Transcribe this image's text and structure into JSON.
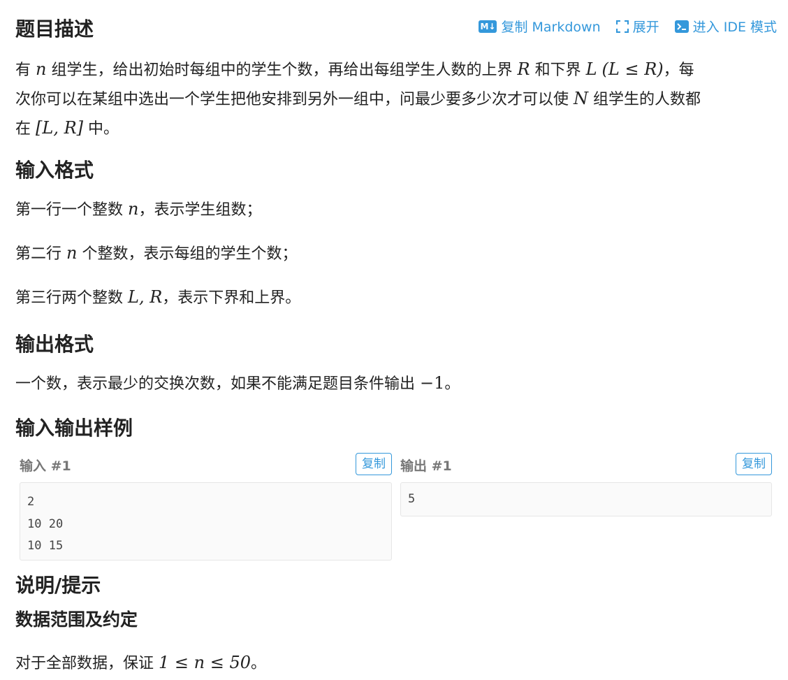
{
  "header": {
    "title": "题目描述",
    "actions": {
      "copy_markdown": "复制 Markdown",
      "expand": "展开",
      "ide_mode": "进入 IDE 模式"
    }
  },
  "description": {
    "p1": "有",
    "n": "n",
    "p2": "组学生，给出初始时每组中的学生个数，再给出每组学生人数的上界",
    "R": "R",
    "p3": "和下界",
    "L": "L",
    "cond": "(L ≤ R)",
    "p4": "，每",
    "line2a": "次你可以在某组中选出一个学生把他安排到另外一组中，问最少要多少次才可以使",
    "N": "N",
    "line2b": "组学生的人数都",
    "line3a": "在",
    "interval": "[L, R]",
    "line3b": "中。"
  },
  "input_format": {
    "title": "输入格式",
    "line1a": "第一行一个整数",
    "line1m": "n",
    "line1b": "，表示学生组数；",
    "line2a": "第二行",
    "line2m": "n",
    "line2b": "个整数，表示每组的学生个数；",
    "line3a": "第三行两个整数",
    "line3m": "L, R",
    "line3b": "，表示下界和上界。"
  },
  "output_format": {
    "title": "输出格式",
    "linea": "一个数，表示最少的交换次数，如果不能满足题目条件输出",
    "linem": "−1",
    "lineb": "。"
  },
  "samples": {
    "title": "输入输出样例",
    "input_label": "输入 #1",
    "output_label": "输出 #1",
    "copy_label": "复制",
    "input_lines": [
      "2",
      "10 20",
      "10 15"
    ],
    "output_lines": [
      "5"
    ]
  },
  "hint": {
    "title": "说明/提示",
    "subtitle": "数据范围及约定",
    "linea": "对于全部数据，保证",
    "linem": "1 ≤ n ≤ 50",
    "lineb": "。"
  },
  "colors": {
    "accent": "#3498db",
    "text": "#222222",
    "muted": "#777777",
    "code_bg": "#fafafa"
  }
}
